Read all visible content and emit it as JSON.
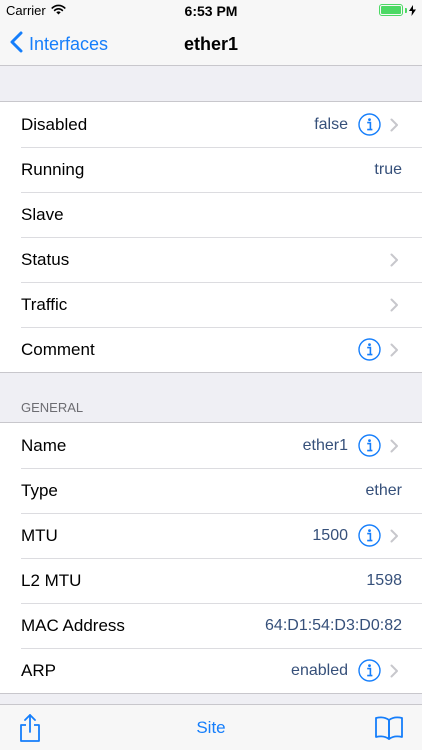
{
  "status_bar": {
    "carrier": "Carrier",
    "time": "6:53 PM"
  },
  "nav": {
    "back_label": "Interfaces",
    "title": "ether1"
  },
  "group1": [
    {
      "label": "Disabled",
      "value": "false",
      "info": true,
      "chevron": true
    },
    {
      "label": "Running",
      "value": "true",
      "info": false,
      "chevron": false
    },
    {
      "label": "Slave",
      "value": "",
      "info": false,
      "chevron": false
    },
    {
      "label": "Status",
      "value": "",
      "info": false,
      "chevron": true
    },
    {
      "label": "Traffic",
      "value": "",
      "info": false,
      "chevron": true
    },
    {
      "label": "Comment",
      "value": "",
      "info": true,
      "chevron": true
    }
  ],
  "general": {
    "header": "GENERAL",
    "rows": [
      {
        "label": "Name",
        "value": "ether1",
        "info": true,
        "chevron": true
      },
      {
        "label": "Type",
        "value": "ether",
        "info": false,
        "chevron": false
      },
      {
        "label": "MTU",
        "value": "1500",
        "info": true,
        "chevron": true
      },
      {
        "label": "L2 MTU",
        "value": "1598",
        "info": false,
        "chevron": false
      },
      {
        "label": "MAC Address",
        "value": "64:D1:54:D3:D0:82",
        "info": false,
        "chevron": false
      },
      {
        "label": "ARP",
        "value": "enabled",
        "info": true,
        "chevron": true
      }
    ]
  },
  "toolbar": {
    "center_label": "Site"
  },
  "icons": {
    "wifi": "wifi-icon",
    "battery": "battery-icon",
    "back": "chevron-left-icon",
    "info": "info-icon",
    "chevron": "chevron-right-icon",
    "share": "share-icon",
    "book": "book-icon"
  },
  "colors": {
    "accent": "#157efb",
    "value_text": "#36507a",
    "battery": "#4cd964"
  }
}
